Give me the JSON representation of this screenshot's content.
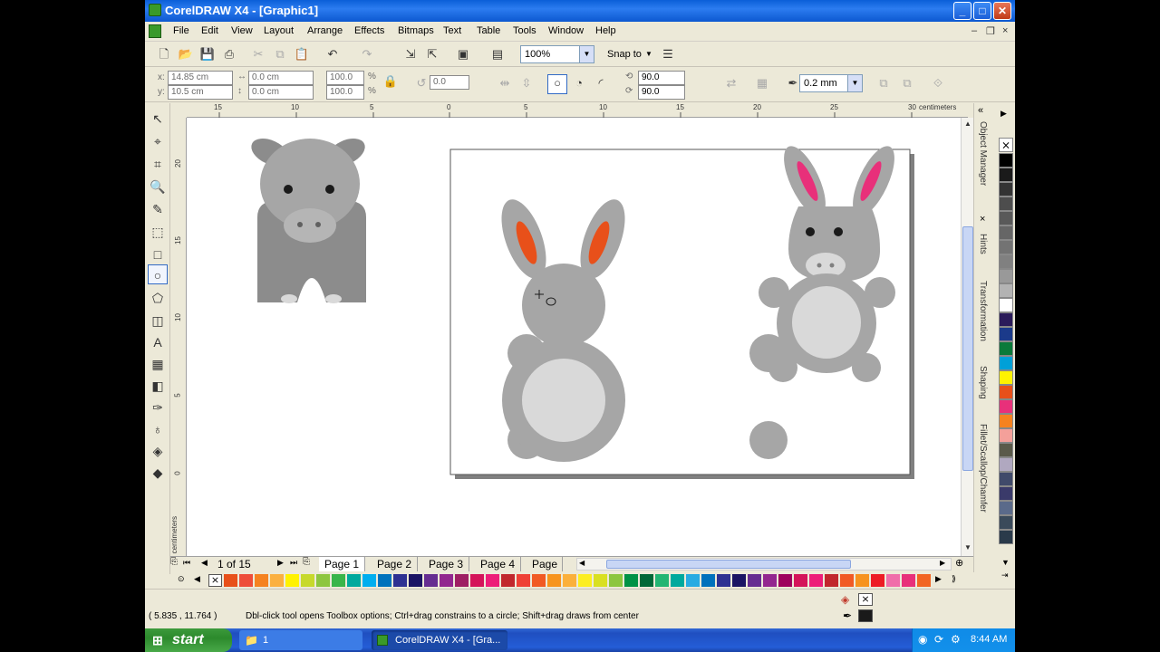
{
  "window": {
    "title": "CorelDRAW X4 - [Graphic1]",
    "min": "_",
    "max": "□",
    "close": "✕"
  },
  "menu": [
    "File",
    "Edit",
    "View",
    "Layout",
    "Arrange",
    "Effects",
    "Bitmaps",
    "Text",
    "Table",
    "Tools",
    "Window",
    "Help"
  ],
  "mdi": {
    "min": "–",
    "restore": "❐",
    "close": "×"
  },
  "standard_toolbar": {
    "zoom": "100%",
    "snap_to": "Snap to"
  },
  "property_bar": {
    "x_label": "x:",
    "x": "14.85 cm",
    "y_label": "y:",
    "y": "10.5 cm",
    "w": "0.0 cm",
    "h": "0.0 cm",
    "scale_w": "100.0",
    "scale_h": "100.0",
    "pct": "%",
    "rotation": "0.0",
    "start_angle": "90.0",
    "end_angle": "90.0",
    "outline_width": "0.2 mm"
  },
  "rulers": {
    "top_ticks": [
      "15",
      "10",
      "5",
      "0",
      "5",
      "10",
      "15",
      "20",
      "25",
      "30"
    ],
    "top_unit": "centimeters",
    "left_ticks": [
      "20",
      "15",
      "10",
      "5",
      "0"
    ],
    "left_unit": "centimeters"
  },
  "docker_tabs": [
    "Object Manager",
    "Hints",
    "Transformation",
    "Shaping",
    "Fillet/Scallop/Chamfer"
  ],
  "pages": {
    "counter": "1 of 15",
    "tabs": [
      "Page 1",
      "Page 2",
      "Page 3",
      "Page 4",
      "Page"
    ]
  },
  "status": {
    "coords": "( 5.835 , 11.764 )",
    "hint": "Dbl-click tool opens Toolbox options; Ctrl+drag constrains to a circle; Shift+drag draws from center"
  },
  "taskbar": {
    "start": "start",
    "items": [
      "1",
      "CorelDRAW X4 - [Gra..."
    ],
    "clock": "8:44 AM"
  },
  "colors": {
    "gray_dark": "#8c8c8c",
    "gray_mid": "#a6a6a6",
    "gray_light": "#d9d9d9",
    "orange": "#e8501a",
    "pink": "#e8307a",
    "black": "#1a1a1a"
  }
}
